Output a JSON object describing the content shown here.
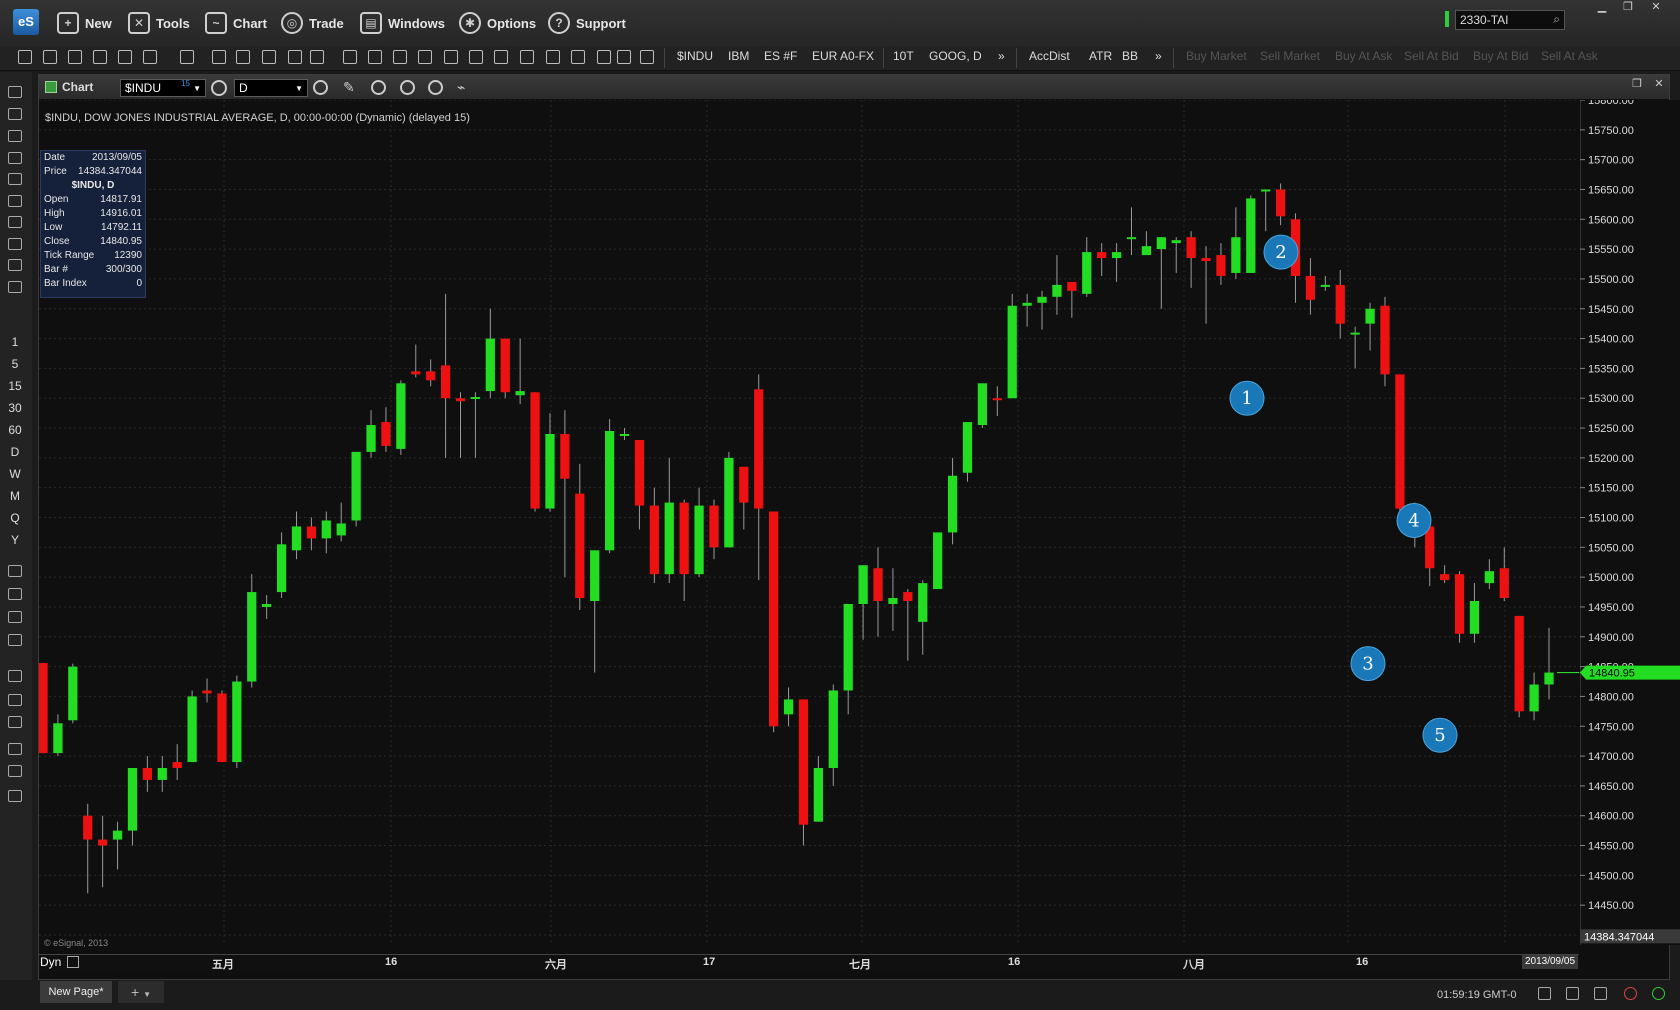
{
  "menu": {
    "logo": "eS",
    "items": [
      "New",
      "Tools",
      "Chart",
      "Trade",
      "Windows",
      "Options",
      "Support"
    ],
    "symbol_input": "2330-TAI"
  },
  "toolbar": {
    "symbols": [
      "$INDU",
      "IBM",
      "ES #F",
      "EUR A0-FX",
      "10T",
      "GOOG, D"
    ],
    "more": "»",
    "studies": [
      "AccDist",
      "ATR",
      "BB"
    ],
    "more2": "»",
    "trade_buttons": [
      "Buy Market",
      "Sell Market",
      "Buy At Ask",
      "Sell At Bid",
      "Buy At Bid",
      "Sell At Ask"
    ]
  },
  "leftbar": {
    "intervals": [
      "1",
      "5",
      "15",
      "30",
      "60",
      "D",
      "W",
      "M",
      "Q",
      "Y"
    ]
  },
  "chart": {
    "title": "Chart",
    "symbol": "$INDU",
    "symbol_sup": "15",
    "interval": "D",
    "description": "$INDU, DOW JONES INDUSTRIAL AVERAGE, D, 00:00-00:00 (Dynamic) (delayed 15)",
    "copyright": "© eSignal, 2013",
    "dyn": "Dyn",
    "date_label": "2013/09/05",
    "infobox": {
      "date_label": "Date",
      "date": "2013/09/05",
      "price_label": "Price",
      "price": "14384.347044",
      "header": "$INDU, D",
      "rows": [
        {
          "k": "Open",
          "v": "14817.91"
        },
        {
          "k": "High",
          "v": "14916.01"
        },
        {
          "k": "Low",
          "v": "14792.11"
        },
        {
          "k": "Close",
          "v": "14840.95"
        },
        {
          "k": "Tick Range",
          "v": "12390"
        },
        {
          "k": "Bar #",
          "v": "300/300"
        },
        {
          "k": "Bar Index",
          "v": "0"
        }
      ]
    },
    "last_price_tag": "14840.95",
    "cursor_price_tag": "14384.347044",
    "x_labels": [
      "五月",
      "16",
      "六月",
      "17",
      "七月",
      "16",
      "八月",
      "16"
    ]
  },
  "status": {
    "page_tab": "New Page*",
    "add_tab": "+",
    "clock": "01:59:19 GMT-0"
  },
  "chart_data": {
    "type": "candlestick",
    "ylim": [
      14400,
      15800
    ],
    "y_ticks": [
      14400,
      14450,
      14500,
      14550,
      14600,
      14650,
      14700,
      14750,
      14800,
      14850,
      14900,
      14950,
      15000,
      15050,
      15100,
      15150,
      15200,
      15250,
      15300,
      15350,
      15400,
      15450,
      15500,
      15550,
      15600,
      15650,
      15700,
      15750,
      15800
    ],
    "candles": [
      [
        14856,
        14705,
        14856,
        14705
      ],
      [
        14705,
        14755,
        14770,
        14700
      ],
      [
        14760,
        14850,
        14855,
        14755
      ],
      [
        14600,
        14560,
        14620,
        14470
      ],
      [
        14560,
        14550,
        14600,
        14480
      ],
      [
        14560,
        14575,
        14590,
        14510
      ],
      [
        14575,
        14680,
        14680,
        14550
      ],
      [
        14680,
        14660,
        14700,
        14640
      ],
      [
        14660,
        14680,
        14700,
        14640
      ],
      [
        14690,
        14680,
        14720,
        14660
      ],
      [
        14690,
        14800,
        14810,
        14690
      ],
      [
        14810,
        14805,
        14830,
        14790
      ],
      [
        14805,
        14690,
        14810,
        14690
      ],
      [
        14690,
        14825,
        14835,
        14680
      ],
      [
        14825,
        14975,
        15005,
        14815
      ],
      [
        14950,
        14955,
        14970,
        14930
      ],
      [
        14975,
        15055,
        15075,
        14965
      ],
      [
        15045,
        15085,
        15110,
        15030
      ],
      [
        15085,
        15065,
        15100,
        15045
      ],
      [
        15065,
        15095,
        15110,
        15040
      ],
      [
        15070,
        15090,
        15125,
        15060
      ],
      [
        15095,
        15210,
        15210,
        15085
      ],
      [
        15210,
        15255,
        15280,
        15200
      ],
      [
        15260,
        15220,
        15285,
        15210
      ],
      [
        15215,
        15325,
        15330,
        15205
      ],
      [
        15345,
        15340,
        15390,
        15335
      ],
      [
        15345,
        15330,
        15365,
        15320
      ],
      [
        15355,
        15300,
        15475,
        15200
      ],
      [
        15300,
        15295,
        15310,
        15200
      ],
      [
        15300,
        15302,
        15310,
        15200
      ],
      [
        15312,
        15400,
        15450,
        15300
      ],
      [
        15400,
        15310,
        15400,
        15300
      ],
      [
        15305,
        15312,
        15400,
        15290
      ],
      [
        15310,
        15115,
        15310,
        15110
      ],
      [
        15115,
        15240,
        15275,
        15110
      ],
      [
        15240,
        15165,
        15280,
        15000
      ],
      [
        15140,
        14965,
        15190,
        14945
      ],
      [
        14960,
        15045,
        15045,
        14840
      ],
      [
        15045,
        15245,
        15265,
        15040
      ],
      [
        15240,
        15240,
        15250,
        15230
      ],
      [
        15230,
        15120,
        15230,
        15080
      ],
      [
        15120,
        15005,
        15150,
        14990
      ],
      [
        15005,
        15125,
        15200,
        14990
      ],
      [
        15125,
        15005,
        15130,
        14960
      ],
      [
        15005,
        15120,
        15150,
        15000
      ],
      [
        15120,
        15050,
        15130,
        15030
      ],
      [
        15050,
        15200,
        15210,
        15050
      ],
      [
        15185,
        15125,
        15185,
        15080
      ],
      [
        15315,
        15115,
        15340,
        14995
      ],
      [
        15110,
        14750,
        15110,
        14740
      ],
      [
        14770,
        14795,
        14815,
        14750
      ],
      [
        14795,
        14585,
        14795,
        14550
      ],
      [
        14590,
        14680,
        14700,
        14590
      ],
      [
        14680,
        14810,
        14820,
        14650
      ],
      [
        14810,
        14955,
        14955,
        14770
      ],
      [
        14955,
        15020,
        15020,
        14895
      ],
      [
        15015,
        14960,
        15050,
        14900
      ],
      [
        14955,
        14965,
        15015,
        14910
      ],
      [
        14975,
        14960,
        14980,
        14860
      ],
      [
        14925,
        14990,
        14995,
        14870
      ],
      [
        14980,
        15075,
        15075,
        14990
      ],
      [
        15075,
        15170,
        15200,
        15055
      ],
      [
        15175,
        15260,
        15255,
        15160
      ],
      [
        15255,
        15325,
        15325,
        15250
      ],
      [
        15300,
        15298,
        15320,
        15270
      ],
      [
        15300,
        15455,
        15475,
        15300
      ],
      [
        15455,
        15460,
        15475,
        15420
      ],
      [
        15460,
        15470,
        15480,
        15415
      ],
      [
        15470,
        15490,
        15540,
        15440
      ],
      [
        15495,
        15480,
        15490,
        15435
      ],
      [
        15475,
        15545,
        15570,
        15470
      ],
      [
        15545,
        15535,
        15560,
        15505
      ],
      [
        15535,
        15545,
        15560,
        15495
      ],
      [
        15570,
        15570,
        15620,
        15540
      ],
      [
        15540,
        15555,
        15580,
        15540
      ],
      [
        15550,
        15570,
        15570,
        15450
      ],
      [
        15560,
        15565,
        15570,
        15510
      ],
      [
        15570,
        15535,
        15580,
        15485
      ],
      [
        15535,
        15530,
        15555,
        15425
      ],
      [
        15540,
        15505,
        15560,
        15490
      ],
      [
        15510,
        15570,
        15620,
        15500
      ],
      [
        15510,
        15635,
        15640,
        15510
      ],
      [
        15650,
        15650,
        15650,
        15580
      ],
      [
        15650,
        15605,
        15660,
        15590
      ],
      [
        15600,
        15505,
        15610,
        15460
      ],
      [
        15505,
        15465,
        15535,
        15440
      ],
      [
        15490,
        15490,
        15505,
        15480
      ],
      [
        15490,
        15425,
        15515,
        15400
      ],
      [
        15410,
        15410,
        15420,
        15350
      ],
      [
        15425,
        15450,
        15460,
        15380
      ],
      [
        15455,
        15340,
        15470,
        15320
      ],
      [
        15340,
        15115,
        15340,
        15100
      ],
      [
        15115,
        15085,
        15125,
        15050
      ],
      [
        15085,
        15015,
        15110,
        14985
      ],
      [
        15005,
        14995,
        15020,
        14990
      ],
      [
        15005,
        14905,
        15010,
        14890
      ],
      [
        14905,
        14960,
        14990,
        14890
      ],
      [
        14990,
        15010,
        15030,
        14980
      ],
      [
        15015,
        14965,
        15050,
        14960
      ],
      [
        14935,
        14775,
        14935,
        14765
      ],
      [
        14775,
        14820,
        14840,
        14760
      ],
      [
        14820,
        14840,
        14915,
        14795
      ]
    ]
  }
}
